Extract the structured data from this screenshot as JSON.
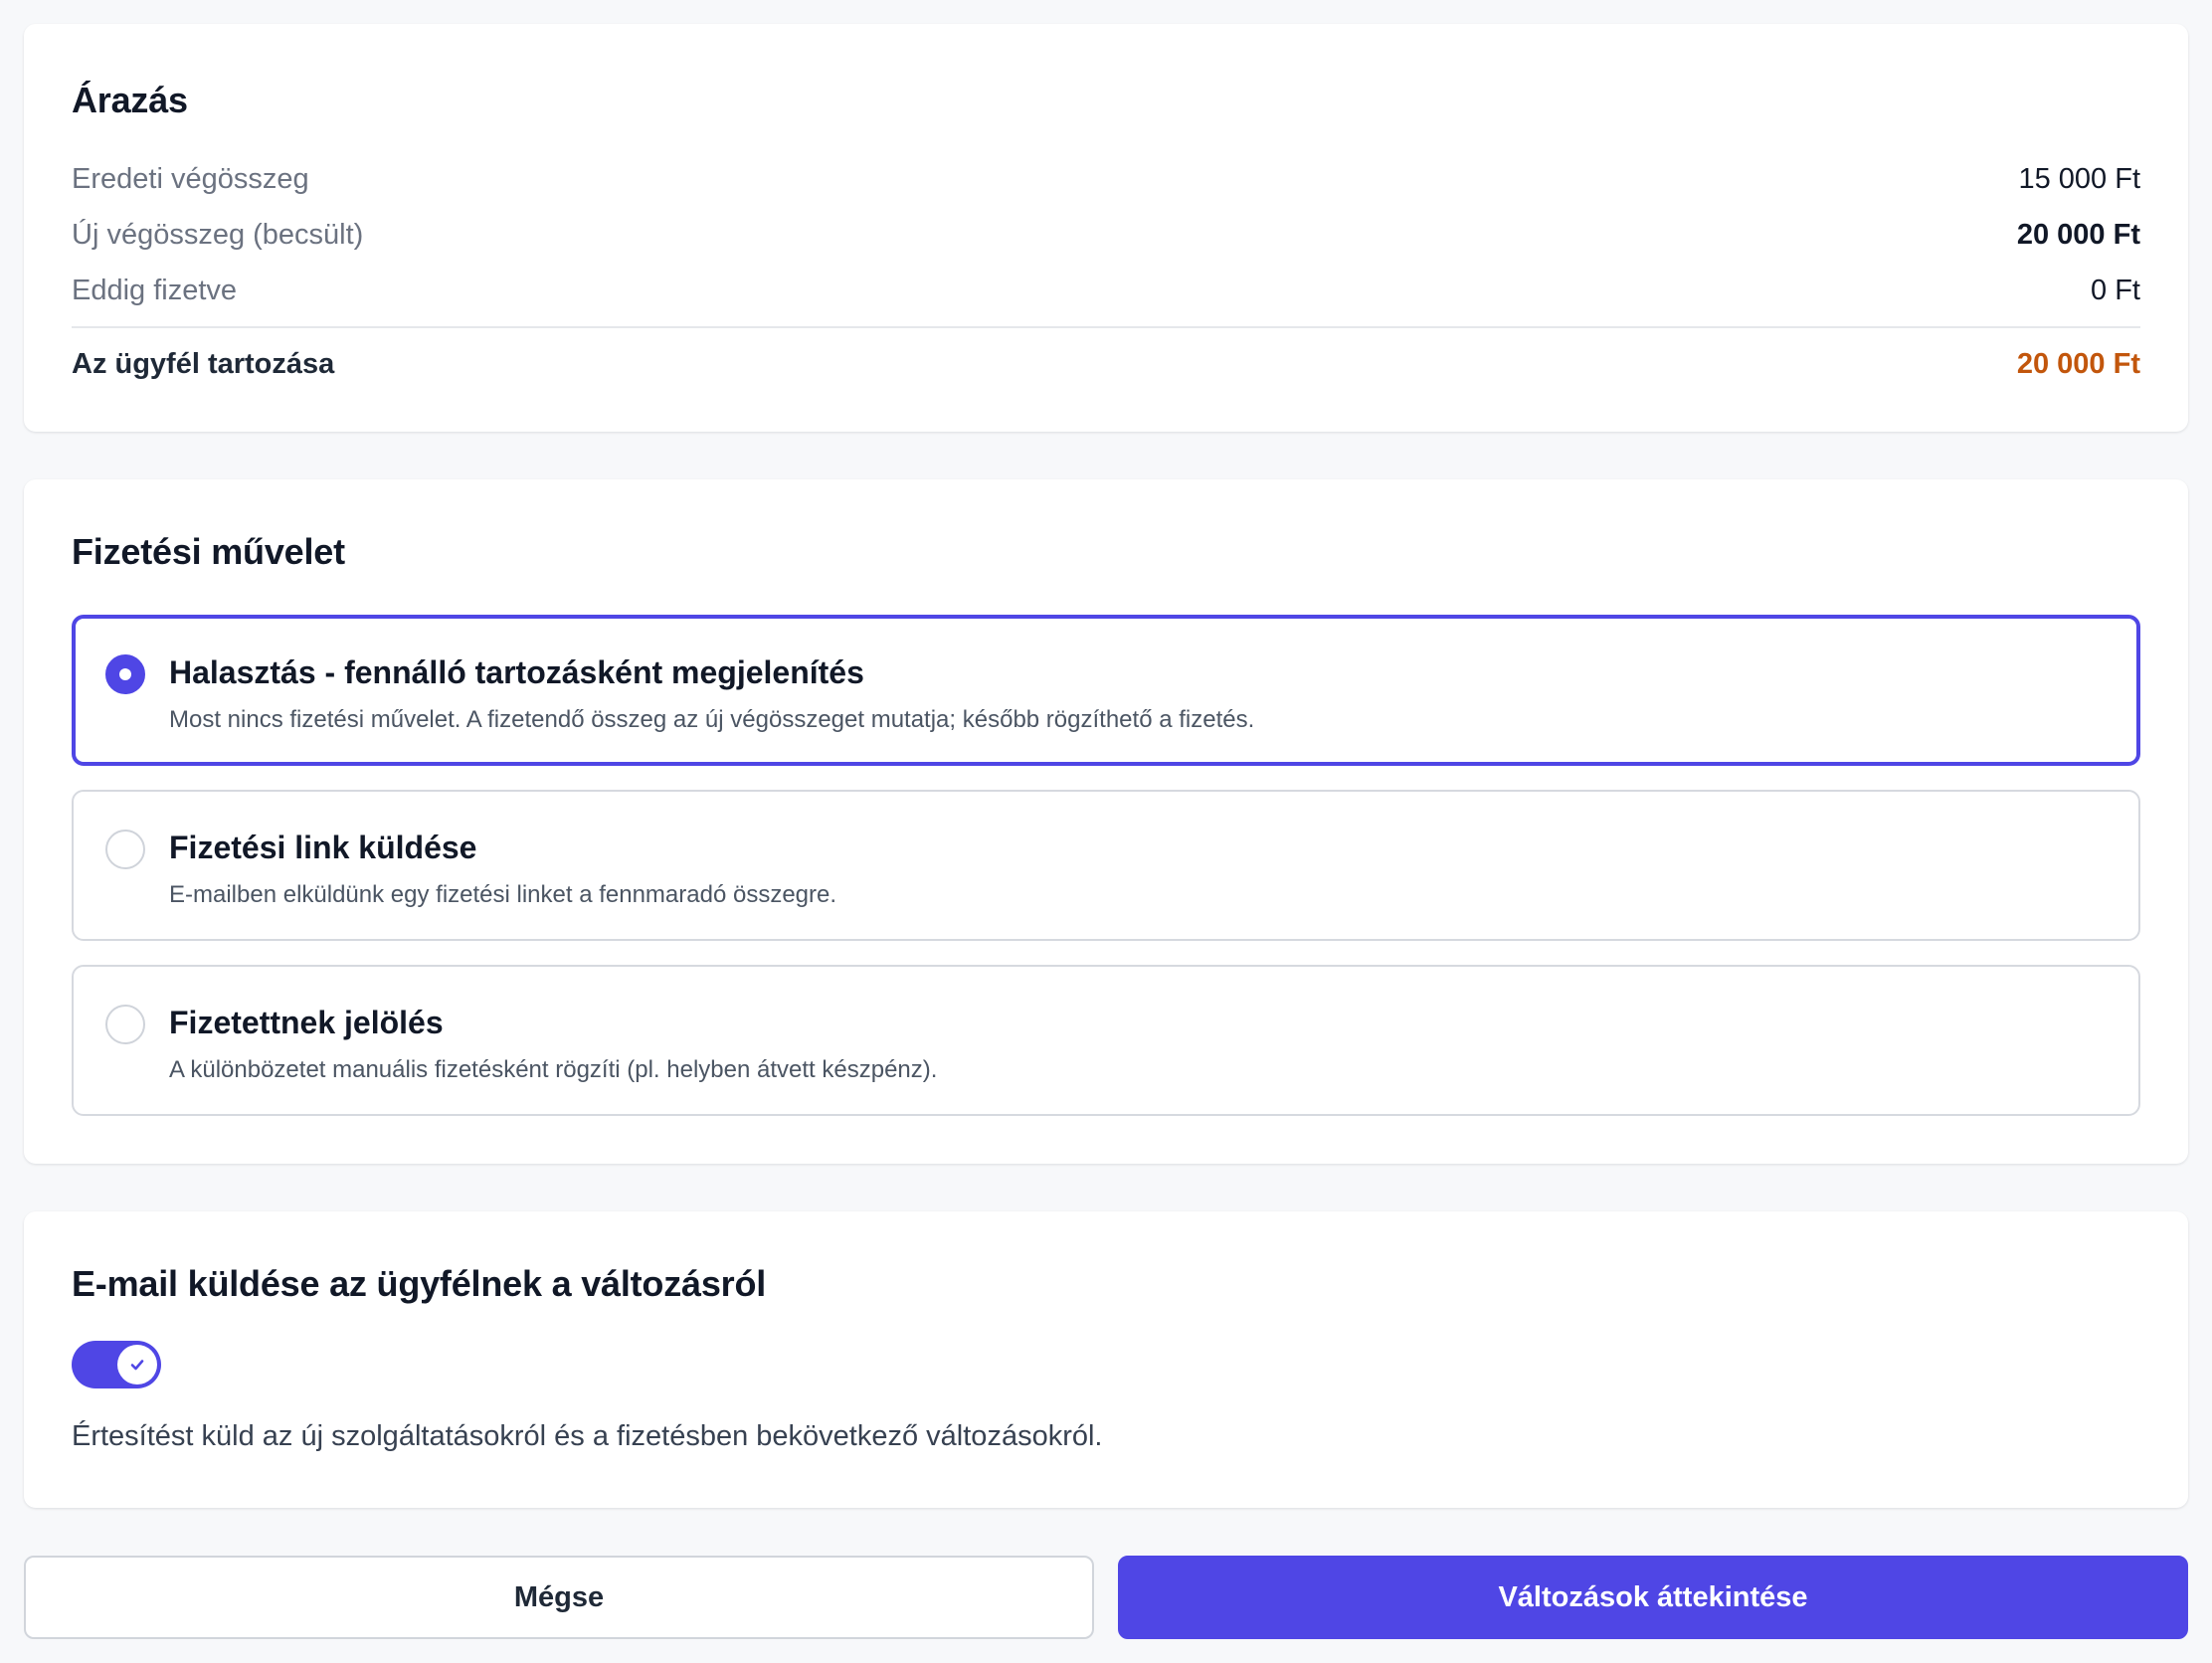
{
  "colors": {
    "accent": "#4f46e5",
    "debt_value": "#c2560c",
    "muted_text": "#6b7280",
    "border": "#d6d9df"
  },
  "pricing": {
    "title": "Árazás",
    "rows": [
      {
        "label": "Eredeti végösszeg",
        "value": "15 000 Ft"
      },
      {
        "label": "Új végösszeg (becsült)",
        "value": "20 000 Ft"
      },
      {
        "label": "Eddig fizetve",
        "value": "0 Ft"
      }
    ],
    "total": {
      "label": "Az ügyfél tartozása",
      "value": "20 000 Ft"
    }
  },
  "payment": {
    "title": "Fizetési művelet",
    "selected_index": 0,
    "options": [
      {
        "title": "Halasztás - fennálló tartozásként megjelenítés",
        "description": "Most nincs fizetési művelet. A fizetendő összeg az új végösszeget mutatja; később rögzíthető a fizetés."
      },
      {
        "title": "Fizetési link küldése",
        "description": "E-mailben elküldünk egy fizetési linket a fennmaradó összegre."
      },
      {
        "title": "Fizetettnek jelölés",
        "description": "A különbözetet manuális fizetésként rögzíti (pl. helyben átvett készpénz)."
      }
    ]
  },
  "email": {
    "title": "E-mail küldése az ügyfélnek a változásról",
    "toggle_on": true,
    "toggle_icon": "check-icon",
    "description": "Értesítést küld az új szolgáltatásokról és a fizetésben bekövetkező változásokról."
  },
  "actions": {
    "cancel_label": "Mégse",
    "primary_label": "Változások áttekintése"
  }
}
